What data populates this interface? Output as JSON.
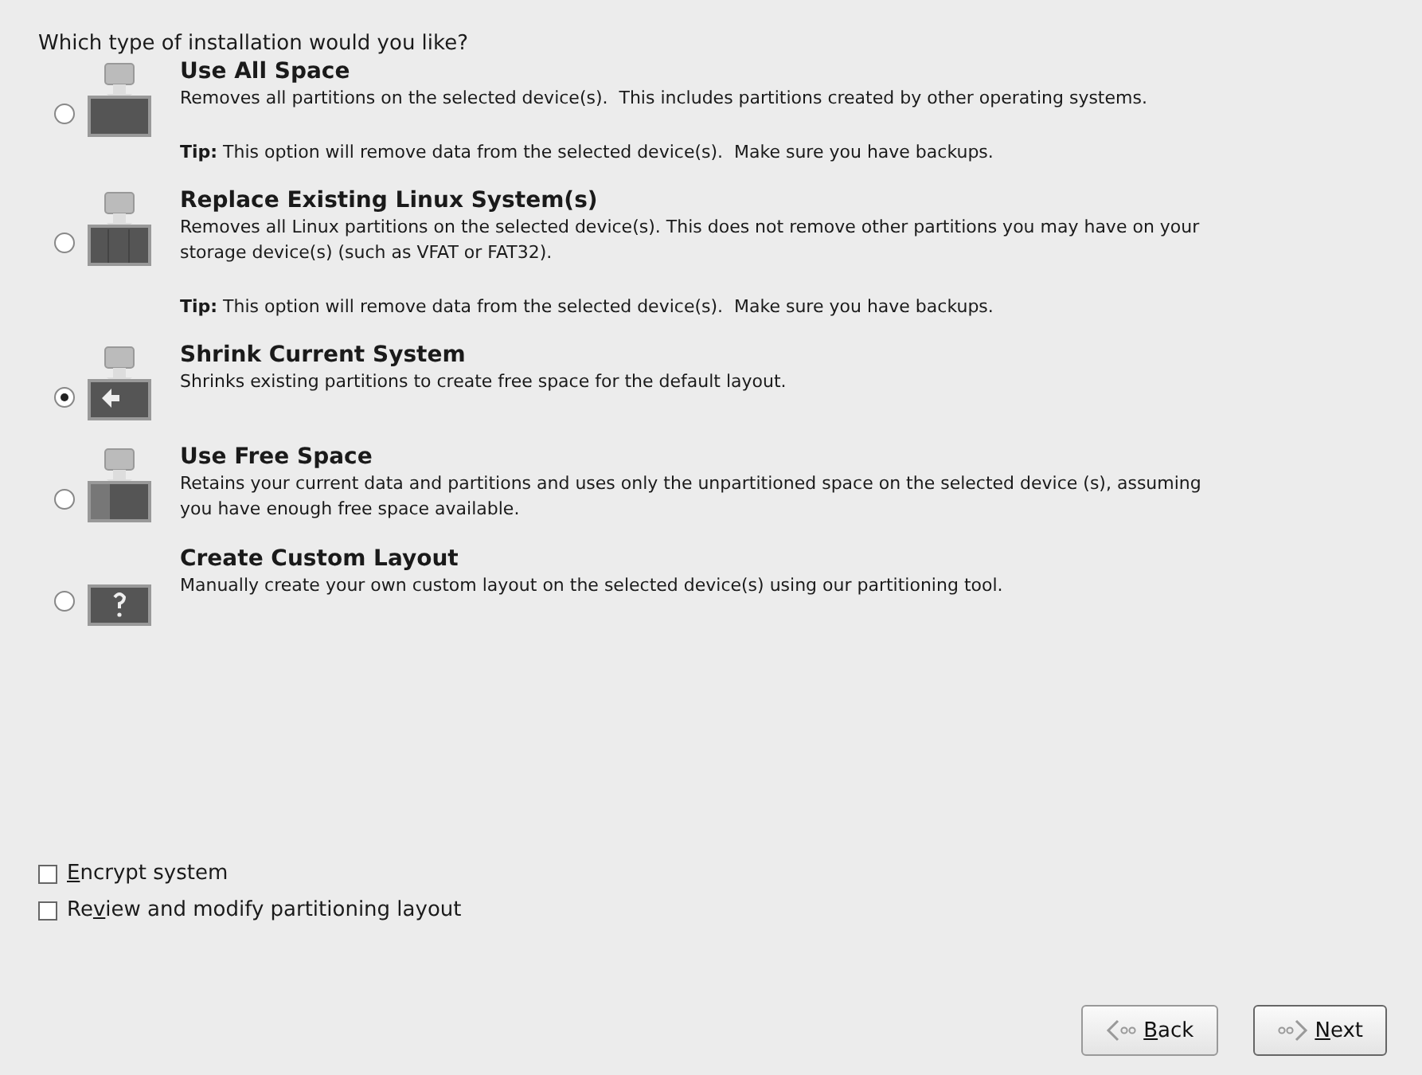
{
  "question": "Which type of installation would you like?",
  "options": [
    {
      "kind": "erase",
      "title": "Use All Space",
      "description": "Removes all partitions on the selected device(s).  This includes partitions created by other operating systems.",
      "tip": "**Tip:** This option will remove data from the selected device(s).  Make sure you have backups.",
      "selected": false
    },
    {
      "kind": "replace",
      "title": "Replace Existing Linux System(s)",
      "description": "Removes all Linux partitions on the selected device(s). This does not remove other partitions you may have on your storage device(s) (such as VFAT or FAT32).",
      "tip": "**Tip:** This option will remove data from the selected device(s).  Make sure you have backups.",
      "selected": false
    },
    {
      "kind": "shrink",
      "title": "Shrink Current System",
      "description": "Shrinks existing partitions to create free space for the default layout.",
      "selected": true
    },
    {
      "kind": "free",
      "title": "Use Free Space",
      "description": "Retains your current data and partitions and uses only the unpartitioned space on the selected device (s), assuming you have enough free space available.",
      "selected": false
    },
    {
      "kind": "custom",
      "title": "Create Custom Layout",
      "description": "Manually create your own custom layout on the selected device(s) using our partitioning tool.",
      "selected": false
    }
  ],
  "checkboxes": [
    {
      "mnemonic": "E",
      "after": "ncrypt system",
      "checked": false
    },
    {
      "before": "Re",
      "mnemonic": "v",
      "after": "iew and modify partitioning layout",
      "checked": false
    }
  ],
  "buttons": [
    {
      "kind": "back",
      "mnemonic": "B",
      "after": "ack"
    },
    {
      "kind": "next",
      "mnemonic": "N",
      "after": "ext"
    }
  ]
}
